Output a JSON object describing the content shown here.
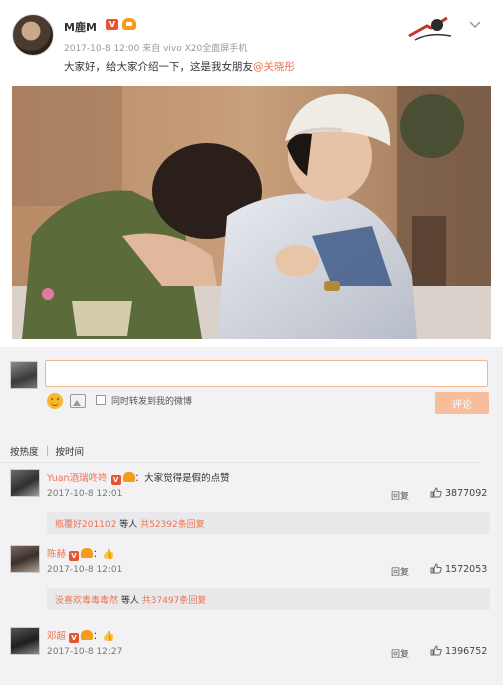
{
  "post": {
    "username": "M鹿M",
    "vip_badge": "V",
    "meta": "2017-10-8 12:00 来自 vivo X20全面屏手机",
    "text_before": "大家好，给大家介绍一下，这是我女朋友",
    "mention": "@关晓彤"
  },
  "comment_box": {
    "input_value": "",
    "input_placeholder": "",
    "repost_label": "同时转发到我的微博",
    "post_button": "评论"
  },
  "sort_tabs": [
    "按热度",
    "按时间"
  ],
  "comments": [
    {
      "name": "Yuan酒瑞咚咚",
      "badge_v": "V",
      "text": "：大家觉得是假的点赞",
      "time": "2017-10-8 12:01",
      "reply_label": "回复",
      "likes": "3877092",
      "sub_user": "瓶覆好201102",
      "sub_mid": " 等人 ",
      "sub_count": "共52392条回复"
    },
    {
      "name": "陈赫",
      "badge_v": "V",
      "text": "：👍",
      "time": "2017-10-8 12:01",
      "reply_label": "回复",
      "likes": "1572053",
      "sub_user": "没喜欢毒毒毒然",
      "sub_mid": " 等人 ",
      "sub_count": "共37497条回复"
    },
    {
      "name": "邓超",
      "badge_v": "V",
      "text": "：👍",
      "time": "2017-10-8 12:27",
      "reply_label": "回复",
      "likes": "1396752"
    }
  ],
  "colors": {
    "accent": "#eb7350",
    "vip": "#e8542f",
    "comment_bg": "#f2f2f5",
    "button_disabled": "#f7be9b"
  },
  "icons": {
    "emoji": "emoji-icon",
    "image": "image-icon",
    "like": "thumbs-up-icon",
    "more": "chevron-down-icon"
  }
}
